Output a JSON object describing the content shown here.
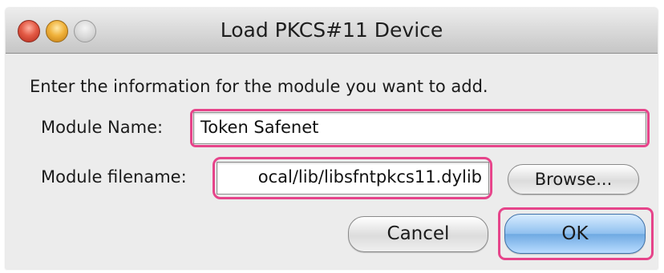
{
  "window": {
    "title": "Load PKCS#11 Device",
    "controls": [
      "close",
      "minimize",
      "zoom"
    ]
  },
  "dialog": {
    "prompt": "Enter the information for the module you want to add.",
    "module_name_label": "Module Name:",
    "module_name_value": "Token Safenet",
    "module_filename_label": "Module filename:",
    "module_filename_value": "ocal/lib/libsfntpkcs11.dylib",
    "browse_label": "Browse...",
    "cancel_label": "Cancel",
    "ok_label": "OK"
  },
  "colors": {
    "highlight": "#e6448a",
    "default_button": "#8fc0ef"
  }
}
